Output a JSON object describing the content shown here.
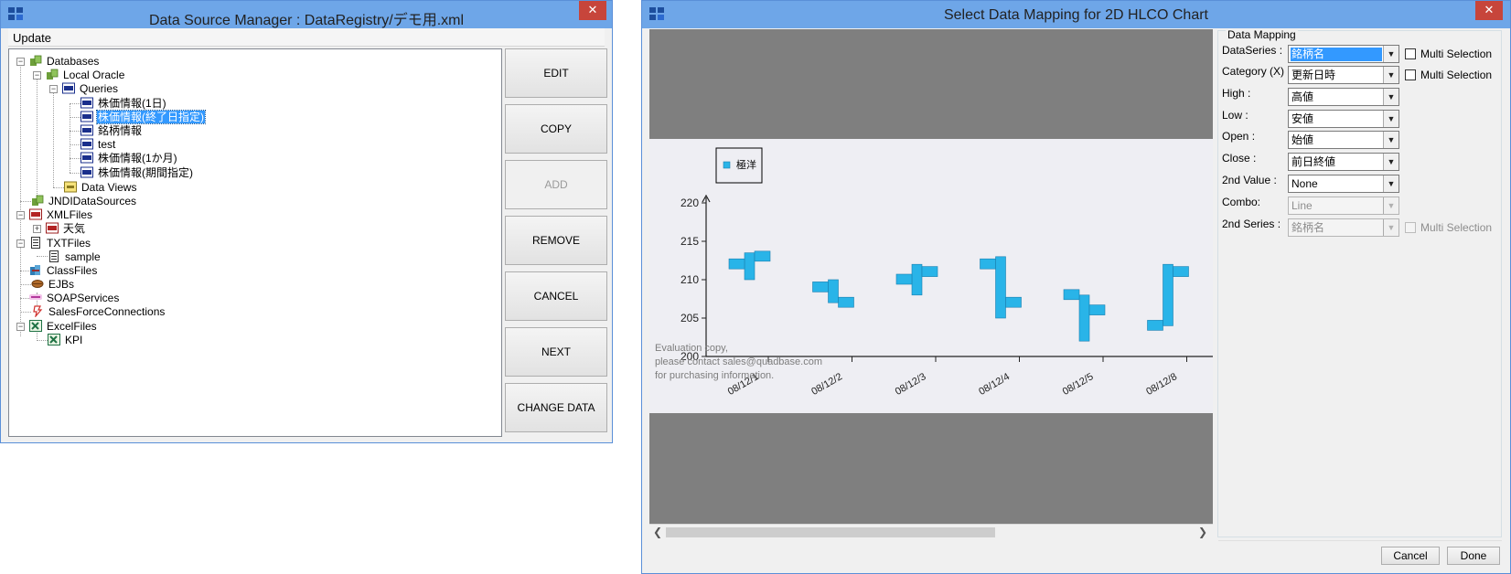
{
  "dsm": {
    "title": "Data Source Manager : DataRegistry/デモ用.xml",
    "close": "✕",
    "menu": {
      "update": "Update"
    },
    "tree": {
      "databases": "Databases",
      "local_oracle": "Local Oracle",
      "queries": "Queries",
      "q1": "株価情報(1日)",
      "q2": "株価情報(終了日指定)",
      "q3": "銘柄情報",
      "q4": "test",
      "q5": "株価情報(1か月)",
      "q6": "株価情報(期間指定)",
      "data_views": "Data Views",
      "jndi": "JNDIDataSources",
      "xml": "XMLFiles",
      "weather": "天気",
      "txt": "TXTFiles",
      "sample": "sample",
      "classfiles": "ClassFiles",
      "ejbs": "EJBs",
      "soap": "SOAPServices",
      "sfc": "SalesForceConnections",
      "excel": "ExcelFiles",
      "kpi": "KPI"
    },
    "buttons": {
      "edit": "EDIT",
      "copy": "COPY",
      "add": "ADD",
      "remove": "REMOVE",
      "cancel": "CANCEL",
      "next": "NEXT",
      "change_data": "CHANGE DATA"
    }
  },
  "sdm": {
    "title": "Select Data Mapping for 2D HLCO Chart",
    "close": "✕",
    "mapping": {
      "group_title": "Data Mapping",
      "dataseries_label": "DataSeries :",
      "dataseries_value": "銘柄名",
      "category_label": "Category (X) :",
      "category_value": "更新日時",
      "high_label": "High  :",
      "high_value": "高値",
      "low_label": "Low   :",
      "low_value": "安値",
      "open_label": "Open  :",
      "open_value": "始値",
      "close_label": "Close :",
      "close_value": "前日終値",
      "second_value_label": "2nd Value :",
      "second_value_value": "None",
      "combo_label": "Combo:",
      "combo_value": "Line",
      "second_series_label": "2nd Series :",
      "second_series_value": "銘柄名",
      "multi_selection": "Multi Selection"
    },
    "cancel_button": "Cancel",
    "done_button": "Done",
    "watermark": [
      "Evaluation copy,",
      "please contact sales@quadbase.com",
      "for purchasing information."
    ]
  },
  "chart_data": {
    "type": "hlco",
    "categories": [
      "08/12/1",
      "08/12/2",
      "08/12/3",
      "08/12/4",
      "08/12/5",
      "08/12/8"
    ],
    "series": [
      {
        "name": "極洋",
        "high": [
          213.5,
          210.0,
          212.0,
          213.0,
          208.0,
          212.0
        ],
        "low": [
          210.0,
          207.0,
          208.0,
          205.0,
          202.0,
          204.0
        ],
        "open": [
          212.0,
          209.0,
          210.0,
          212.0,
          208.0,
          204.0
        ],
        "close": [
          213.0,
          207.0,
          211.0,
          207.0,
          206.0,
          211.0
        ]
      }
    ],
    "ylim": [
      200,
      220
    ],
    "yticks": [
      200,
      205,
      210,
      215,
      220
    ],
    "legend": "top-left",
    "color": "#29b4e8"
  }
}
